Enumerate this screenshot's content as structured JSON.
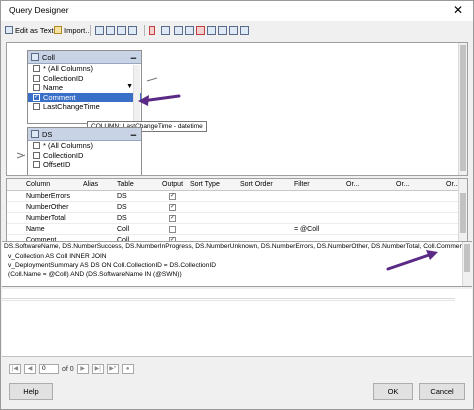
{
  "window": {
    "title": "Query Designer",
    "close_glyph": "✕"
  },
  "toolbar": {
    "edit_as_text": "Edit as Text",
    "import": "Import..."
  },
  "diagram": {
    "table1": {
      "name": "Coll",
      "rows": [
        {
          "label": "* (All Columns)",
          "checked": false
        },
        {
          "label": "CollectionID",
          "checked": false
        },
        {
          "label": "Name",
          "checked": false,
          "filter": true
        },
        {
          "label": "Comment",
          "checked": true,
          "selected": true
        },
        {
          "label": "LastChangeTime",
          "checked": false
        }
      ]
    },
    "table2": {
      "name": "DS",
      "rows": [
        {
          "label": "* (All Columns)",
          "checked": false
        },
        {
          "label": "CollectionID",
          "checked": false
        },
        {
          "label": "OffsetID",
          "checked": false
        }
      ]
    },
    "tooltip": "COLUMN: LastChangeTime - datetime"
  },
  "grid": {
    "headers": [
      "Column",
      "Alias",
      "Table",
      "Output",
      "Sort Type",
      "Sort Order",
      "Filter",
      "Or...",
      "Or...",
      "Or..."
    ],
    "rows": [
      {
        "column": "NumberErrors",
        "alias": "",
        "table": "DS",
        "output": true,
        "filter": ""
      },
      {
        "column": "NumberOther",
        "alias": "",
        "table": "DS",
        "output": true,
        "filter": ""
      },
      {
        "column": "NumberTotal",
        "alias": "",
        "table": "DS",
        "output": true,
        "filter": ""
      },
      {
        "column": "Name",
        "alias": "",
        "table": "Coll",
        "output": false,
        "filter": "= @Coll"
      },
      {
        "column": "Comment",
        "alias": "",
        "table": "Coll",
        "output": true,
        "filter": ""
      }
    ]
  },
  "sql": {
    "lines": [
      "DS.SoftwareName, DS.NumberSuccess, DS.NumberInProgress, DS.NumberUnknown, DS.NumberErrors, DS.NumberOther, DS.NumberTotal, Coll.Comment",
      "v_Collection AS Coll INNER JOIN",
      "  v_DeploymentSummary AS DS ON Coll.CollectionID = DS.CollectionID",
      "(Coll.Name = @Coll) AND (DS.SoftwareName IN (@SWN))"
    ]
  },
  "navigator": {
    "page": "0",
    "of_label": "of 0"
  },
  "buttons": {
    "help": "Help",
    "ok": "OK",
    "cancel": "Cancel"
  },
  "colors": {
    "arrow": "#5b2a86",
    "selection": "#3a6fc8"
  }
}
